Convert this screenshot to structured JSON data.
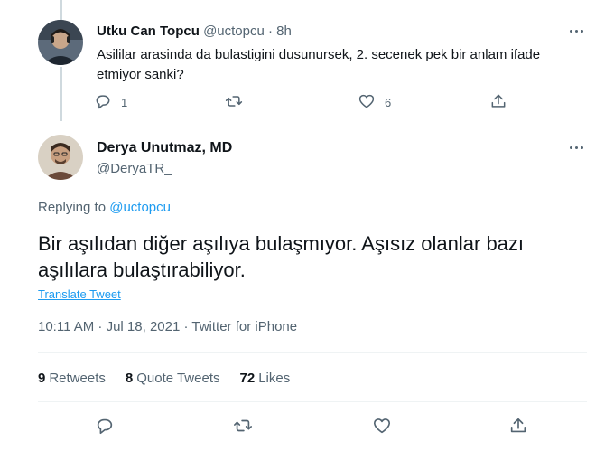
{
  "reply_tweet": {
    "author_name": "Utku Can Topcu",
    "author_handle": "@uctopcu",
    "dot": "·",
    "time": "8h",
    "text": "Asililar arasinda da bulastigini dusunursek, 2. secenek pek bir anlam ifade etmiyor sanki?",
    "reply_count": "1",
    "retweet_count": "",
    "like_count": "6"
  },
  "main_tweet": {
    "author_name": "Derya Unutmaz, MD",
    "author_handle": "@DeryaTR_",
    "replying_prefix": "Replying to",
    "replying_to": "@uctopcu",
    "text": "Bir aşılıdan diğer aşılıya bulaşmıyor. Aşısız olanlar bazı aşılılara bulaştırabiliyor.",
    "translate_label": "Translate Tweet",
    "timestamp": "10:11 AM · Jul 18, 2021 · Twitter for iPhone",
    "stats": {
      "retweets_count": "9",
      "retweets_label": "Retweets",
      "quotes_count": "8",
      "quotes_label": "Quote Tweets",
      "likes_count": "72",
      "likes_label": "Likes"
    }
  },
  "icons": [
    "reply-icon",
    "retweet-icon",
    "like-icon",
    "share-icon",
    "more-icon"
  ],
  "colors": {
    "accent": "#1d9bf0",
    "secondary_text": "#536471",
    "text": "#0f1419",
    "divider": "#eff3f4"
  }
}
